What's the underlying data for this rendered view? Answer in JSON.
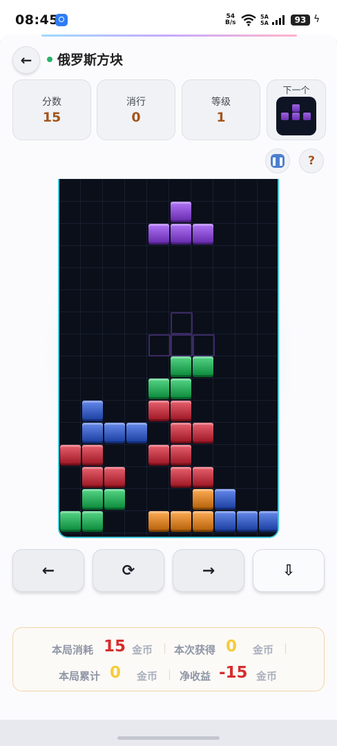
{
  "status_bar": {
    "time": "08:45",
    "net_speed_top": "54",
    "net_speed_bottom": "B/s",
    "sig_top": "5A",
    "sig_bottom": "5A",
    "battery": "93",
    "icons": [
      "app-notification-icon",
      "wifi-icon",
      "signal-icon",
      "battery-icon",
      "charging-icon"
    ]
  },
  "header": {
    "back_icon": "←",
    "title": "俄罗斯方块"
  },
  "stats": [
    {
      "label": "分数",
      "value": "15"
    },
    {
      "label": "消行",
      "value": "0"
    },
    {
      "label": "等级",
      "value": "1"
    }
  ],
  "next_piece": {
    "label": "下一个",
    "shape": "T",
    "color": "#8a4fd0"
  },
  "buttons": {
    "pause_icon": "❚❚",
    "help_icon": "?"
  },
  "colors": {
    "purple": "#8a4fd0",
    "green": "#2fae5f",
    "red": "#c13a48",
    "blue": "#3f63c4",
    "orange": "#d9852e",
    "border": "#3fc6d9",
    "accent": "#a2551e"
  },
  "board": {
    "cols": 10,
    "rows": 16,
    "active_piece": {
      "color": "purple",
      "cells": [
        [
          5,
          1
        ],
        [
          4,
          2
        ],
        [
          5,
          2
        ],
        [
          6,
          2
        ]
      ]
    },
    "ghost_cells": [
      [
        5,
        6
      ],
      [
        4,
        7
      ],
      [
        5,
        7
      ],
      [
        6,
        7
      ]
    ],
    "locked_cells": [
      {
        "c": 5,
        "r": 8,
        "color": "green"
      },
      {
        "c": 6,
        "r": 8,
        "color": "green"
      },
      {
        "c": 4,
        "r": 9,
        "color": "green"
      },
      {
        "c": 5,
        "r": 9,
        "color": "green"
      },
      {
        "c": 1,
        "r": 10,
        "color": "blue"
      },
      {
        "c": 4,
        "r": 10,
        "color": "red"
      },
      {
        "c": 5,
        "r": 10,
        "color": "red"
      },
      {
        "c": 1,
        "r": 11,
        "color": "blue"
      },
      {
        "c": 2,
        "r": 11,
        "color": "blue"
      },
      {
        "c": 3,
        "r": 11,
        "color": "blue"
      },
      {
        "c": 5,
        "r": 11,
        "color": "red"
      },
      {
        "c": 6,
        "r": 11,
        "color": "red"
      },
      {
        "c": 0,
        "r": 12,
        "color": "red"
      },
      {
        "c": 1,
        "r": 12,
        "color": "red"
      },
      {
        "c": 4,
        "r": 12,
        "color": "red"
      },
      {
        "c": 5,
        "r": 12,
        "color": "red"
      },
      {
        "c": 1,
        "r": 13,
        "color": "red"
      },
      {
        "c": 2,
        "r": 13,
        "color": "red"
      },
      {
        "c": 5,
        "r": 13,
        "color": "red"
      },
      {
        "c": 6,
        "r": 13,
        "color": "red"
      },
      {
        "c": 1,
        "r": 14,
        "color": "green"
      },
      {
        "c": 2,
        "r": 14,
        "color": "green"
      },
      {
        "c": 6,
        "r": 14,
        "color": "orange"
      },
      {
        "c": 7,
        "r": 14,
        "color": "blue"
      },
      {
        "c": 0,
        "r": 15,
        "color": "green"
      },
      {
        "c": 1,
        "r": 15,
        "color": "green"
      },
      {
        "c": 4,
        "r": 15,
        "color": "orange"
      },
      {
        "c": 5,
        "r": 15,
        "color": "orange"
      },
      {
        "c": 6,
        "r": 15,
        "color": "orange"
      },
      {
        "c": 7,
        "r": 15,
        "color": "blue"
      },
      {
        "c": 8,
        "r": 15,
        "color": "blue"
      },
      {
        "c": 9,
        "r": 15,
        "color": "blue"
      }
    ]
  },
  "controls": [
    {
      "name": "move-left",
      "icon": "←",
      "icon_name": "arrow-left-icon"
    },
    {
      "name": "rotate",
      "icon": "⟳",
      "icon_name": "rotate-icon"
    },
    {
      "name": "move-right",
      "icon": "→",
      "icon_name": "arrow-right-icon"
    },
    {
      "name": "drop",
      "icon": "⇩",
      "icon_name": "arrow-down-icon"
    }
  ],
  "coins": {
    "cost_label": "本局消耗",
    "cost_value": "15",
    "cost_unit": "金币",
    "gain_label": "本次获得",
    "gain_value": "0",
    "gain_unit": "金币",
    "total_label": "本局累计",
    "total_value": "0",
    "total_unit": "金币",
    "net_label": "净收益",
    "net_value": "-15",
    "net_unit": "金币"
  }
}
